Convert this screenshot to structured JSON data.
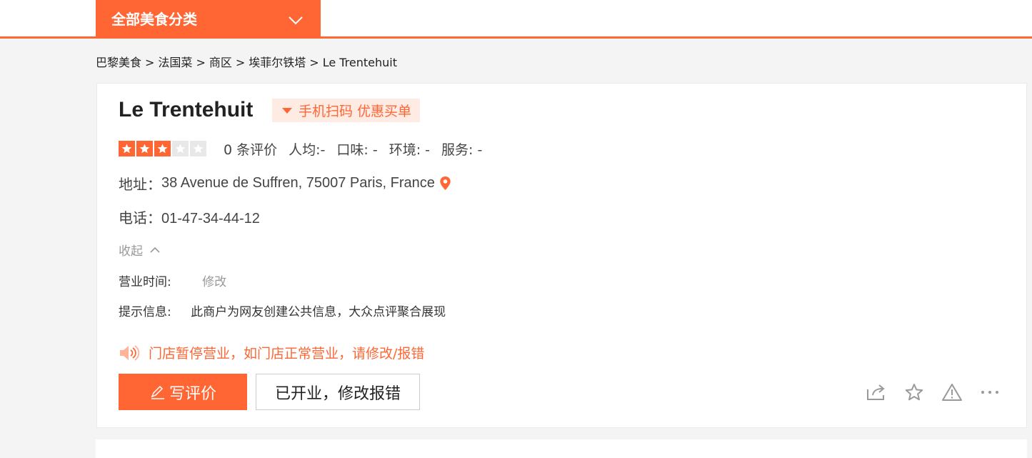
{
  "nav": {
    "category_tab": "全部美食分类"
  },
  "breadcrumb": [
    "巴黎美食",
    "法国菜",
    "商区",
    "埃菲尔铁塔",
    "Le Trentehuit"
  ],
  "breadcrumb_separator": ">",
  "shop": {
    "name": "Le Trentehuit",
    "promo_label": "手机扫码 优惠买单",
    "rating": {
      "stars": 3,
      "max_stars": 5
    },
    "review_count": "0 条评价",
    "avg_price": "人均:-",
    "taste": "口味: -",
    "environment": "环境: -",
    "service": "服务: -",
    "address_label": "地址：",
    "address": "38 Avenue de Suffren, 75007 Paris, France",
    "phone_label": "电话：",
    "phone": "01-47-34-44-12",
    "collapse_label": "收起",
    "hours_label": "营业时间:",
    "hours_edit": "修改",
    "info_label": "提示信息:",
    "info_text": "此商户为网友创建公共信息，大众点评聚合展现",
    "notice": "门店暂停营业，如门店正常营业，请修改/报错"
  },
  "buttons": {
    "write_review": "写评价",
    "report_open": "已开业，修改报错"
  },
  "colors": {
    "accent": "#ff6633",
    "promo_bg": "#fdebe4",
    "icon_gray": "#999999"
  },
  "icons": [
    "chevron-down-icon",
    "location-pin-icon",
    "chevron-up-icon",
    "speaker-icon",
    "pencil-icon",
    "share-icon",
    "star-outline-icon",
    "warning-icon",
    "more-icon"
  ]
}
